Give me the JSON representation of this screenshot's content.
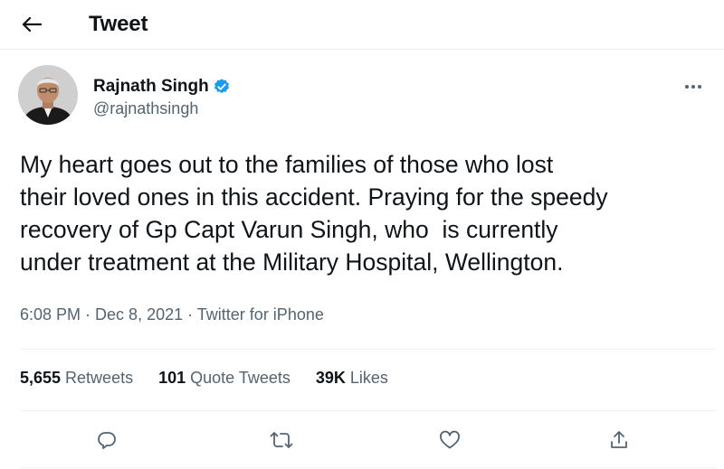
{
  "header": {
    "title": "Tweet",
    "back_icon": "arrow-left-icon"
  },
  "author": {
    "name": "Rajnath Singh",
    "handle": "@rajnathsingh",
    "verified_color": "#1d9bf0",
    "more_icon": "more-horizontal-icon"
  },
  "tweet": {
    "lines": [
      "My heart goes out to the families of those who lost",
      "their loved ones in this accident. Praying for the speedy",
      "recovery of Gp Capt Varun Singh, who  is currently",
      "under treatment at the Military Hospital, Wellington."
    ],
    "time": "6:08 PM",
    "date": "Dec 8, 2021",
    "source": "Twitter for iPhone",
    "separator": " · "
  },
  "stats": {
    "retweets": {
      "count": "5,655",
      "label": " Retweets"
    },
    "quotes": {
      "count": "101",
      "label": " Quote Tweets"
    },
    "likes": {
      "count": "39K",
      "label": " Likes"
    }
  },
  "actions": [
    "reply-icon",
    "retweet-icon",
    "like-icon",
    "share-icon"
  ],
  "colors": {
    "text": "#0f1419",
    "secondary": "#536471",
    "divider": "#eff3f4"
  }
}
